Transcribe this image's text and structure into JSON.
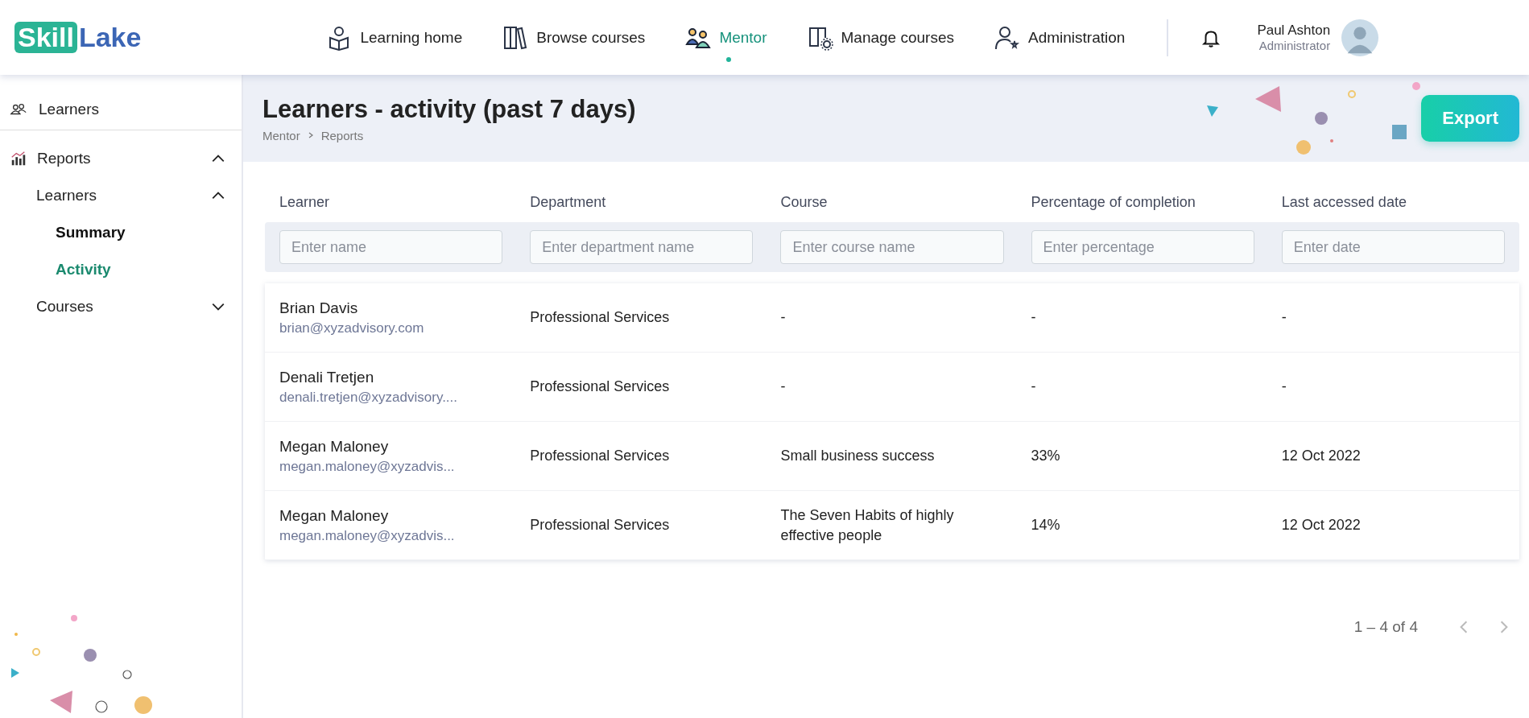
{
  "logo": {
    "highlight": "Skill",
    "rest": "Lake"
  },
  "nav": [
    {
      "label": "Learning home",
      "selected": false
    },
    {
      "label": "Browse courses",
      "selected": false
    },
    {
      "label": "Mentor",
      "selected": true
    },
    {
      "label": "Manage courses",
      "selected": false
    },
    {
      "label": "Administration",
      "selected": false
    }
  ],
  "user": {
    "name": "Paul Ashton",
    "role": "Administrator"
  },
  "sidebar": {
    "top": {
      "label": "Learners"
    },
    "items": [
      {
        "label": "Reports",
        "expanded": true,
        "children": [
          {
            "label": "Learners",
            "expanded": true,
            "children": [
              {
                "label": "Summary",
                "selected": false
              },
              {
                "label": "Activity",
                "selected": true
              }
            ]
          },
          {
            "label": "Courses",
            "expanded": false
          }
        ]
      }
    ]
  },
  "page": {
    "title": "Learners - activity (past 7 days)",
    "breadcrumb": [
      "Mentor",
      "Reports"
    ],
    "export": "Export"
  },
  "table": {
    "columns": [
      {
        "label": "Learner",
        "placeholder": "Enter name"
      },
      {
        "label": "Department",
        "placeholder": "Enter department name"
      },
      {
        "label": "Course",
        "placeholder": "Enter course name"
      },
      {
        "label": "Percentage of completion",
        "placeholder": "Enter percentage"
      },
      {
        "label": "Last accessed date",
        "placeholder": "Enter date"
      }
    ],
    "rows": [
      {
        "name": "Brian Davis",
        "email": "brian@xyzadvisory.com",
        "department": "Professional Services",
        "course": "-",
        "percentage": "-",
        "date": "-"
      },
      {
        "name": "Denali Tretjen",
        "email": "denali.tretjen@xyzadvisory....",
        "department": "Professional Services",
        "course": "-",
        "percentage": "-",
        "date": "-"
      },
      {
        "name": "Megan Maloney",
        "email": "megan.maloney@xyzadvis...",
        "department": "Professional Services",
        "course": "Small business success",
        "percentage": "33%",
        "date": "12 Oct 2022"
      },
      {
        "name": "Megan Maloney",
        "email": "megan.maloney@xyzadvis...",
        "department": "Professional Services",
        "course": "The Seven Habits of highly effective people",
        "percentage": "14%",
        "date": "12 Oct 2022"
      }
    ]
  },
  "pagination": {
    "range": "1 – 4 of 4",
    "prev_disabled": true,
    "next_disabled": true
  }
}
